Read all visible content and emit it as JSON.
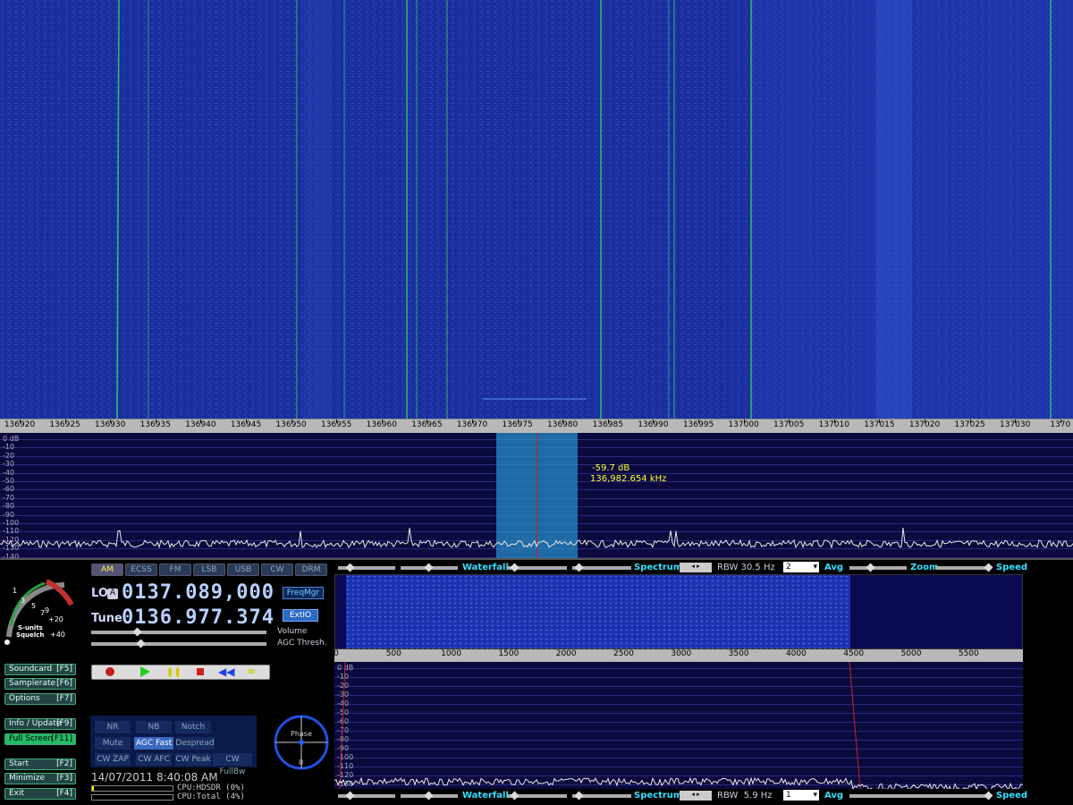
{
  "freq_axis": [
    "136920",
    "136925",
    "136930",
    "136935",
    "136940",
    "136945",
    "136950",
    "136955",
    "136960",
    "136965",
    "136970",
    "136975",
    "136980",
    "136985",
    "136990",
    "136995",
    "137000",
    "137005",
    "137010",
    "137015",
    "137020",
    "137025",
    "137030",
    "1370"
  ],
  "db_scale": [
    "0 dB",
    "-10",
    "-20",
    "-30",
    "-40",
    "-50",
    "-60",
    "-70",
    "-80",
    "-90",
    "-100",
    "-110",
    "-120",
    "-130",
    "-140"
  ],
  "marker": {
    "level": "-59.7 dB",
    "freq": "136,982.654 kHz"
  },
  "modes": [
    "AM",
    "ECSS",
    "FM",
    "LSB",
    "USB",
    "CW",
    "DRM"
  ],
  "active_mode": "AM",
  "lo": {
    "label": "LO",
    "badge": "A",
    "value": "0137.089,000"
  },
  "tune": {
    "label": "Tune",
    "value": "0136.977.374"
  },
  "buttons": {
    "freqmgr": "FreqMgr",
    "extio": "ExtIO"
  },
  "slider_labels": {
    "volume": "Volume",
    "agc": "AGC Thresh."
  },
  "smeter": {
    "label1": "S-units",
    "label2": "Squelch",
    "ticks": [
      "1",
      "3",
      "5",
      "7",
      "9",
      "+20",
      "+40"
    ]
  },
  "side_buttons": [
    {
      "label": "Soundcard",
      "key": "[F5]"
    },
    {
      "label": "Samplerate",
      "key": "[F6]"
    },
    {
      "label": "Options",
      "key": "[F7]"
    },
    {
      "label": "Info / Update",
      "key": "[F9]"
    },
    {
      "label": "Full Screen",
      "key": "[F11]"
    },
    {
      "label": "Start",
      "key": "[F2]"
    },
    {
      "label": "Minimize",
      "key": "[F3]"
    },
    {
      "label": "Exit",
      "key": "[F4]"
    }
  ],
  "dsp": [
    [
      "NR",
      "NB",
      "Notch"
    ],
    [
      "Mute",
      "AGC Fast",
      "Despread"
    ],
    [
      "CW ZAP",
      "CW AFC",
      "CW Peak",
      "CW FullBw"
    ]
  ],
  "phase": {
    "label": "Phase",
    "value": "0"
  },
  "datetime": "14/07/2011 8:40:08 AM",
  "cpu": {
    "hdsdr": "CPU:HDSDR (0%)",
    "total": "CPU:Total (4%)"
  },
  "top_controls": {
    "waterfall": "Waterfall",
    "spectrum": "Spectrum",
    "rbw": "RBW 30.5 Hz",
    "avg": "Avg",
    "avg_val": "2",
    "zoom": "Zoom",
    "speed": "Speed"
  },
  "bottom_controls": {
    "waterfall": "Waterfall",
    "spectrum": "Spectrum",
    "rbw": "RBW  5.9 Hz",
    "avg": "Avg",
    "avg_val": "1",
    "speed": "Speed"
  },
  "audio_axis": [
    "0",
    "500",
    "1000",
    "1500",
    "2000",
    "2500",
    "3000",
    "3500",
    "4000",
    "4500",
    "5000",
    "5500"
  ],
  "audio_db": [
    "0 dB",
    "-10",
    "-20",
    "-30",
    "-40",
    "-50",
    "-60",
    "-70",
    "-80",
    "-90",
    "-100",
    "-110",
    "-120",
    "-130"
  ]
}
